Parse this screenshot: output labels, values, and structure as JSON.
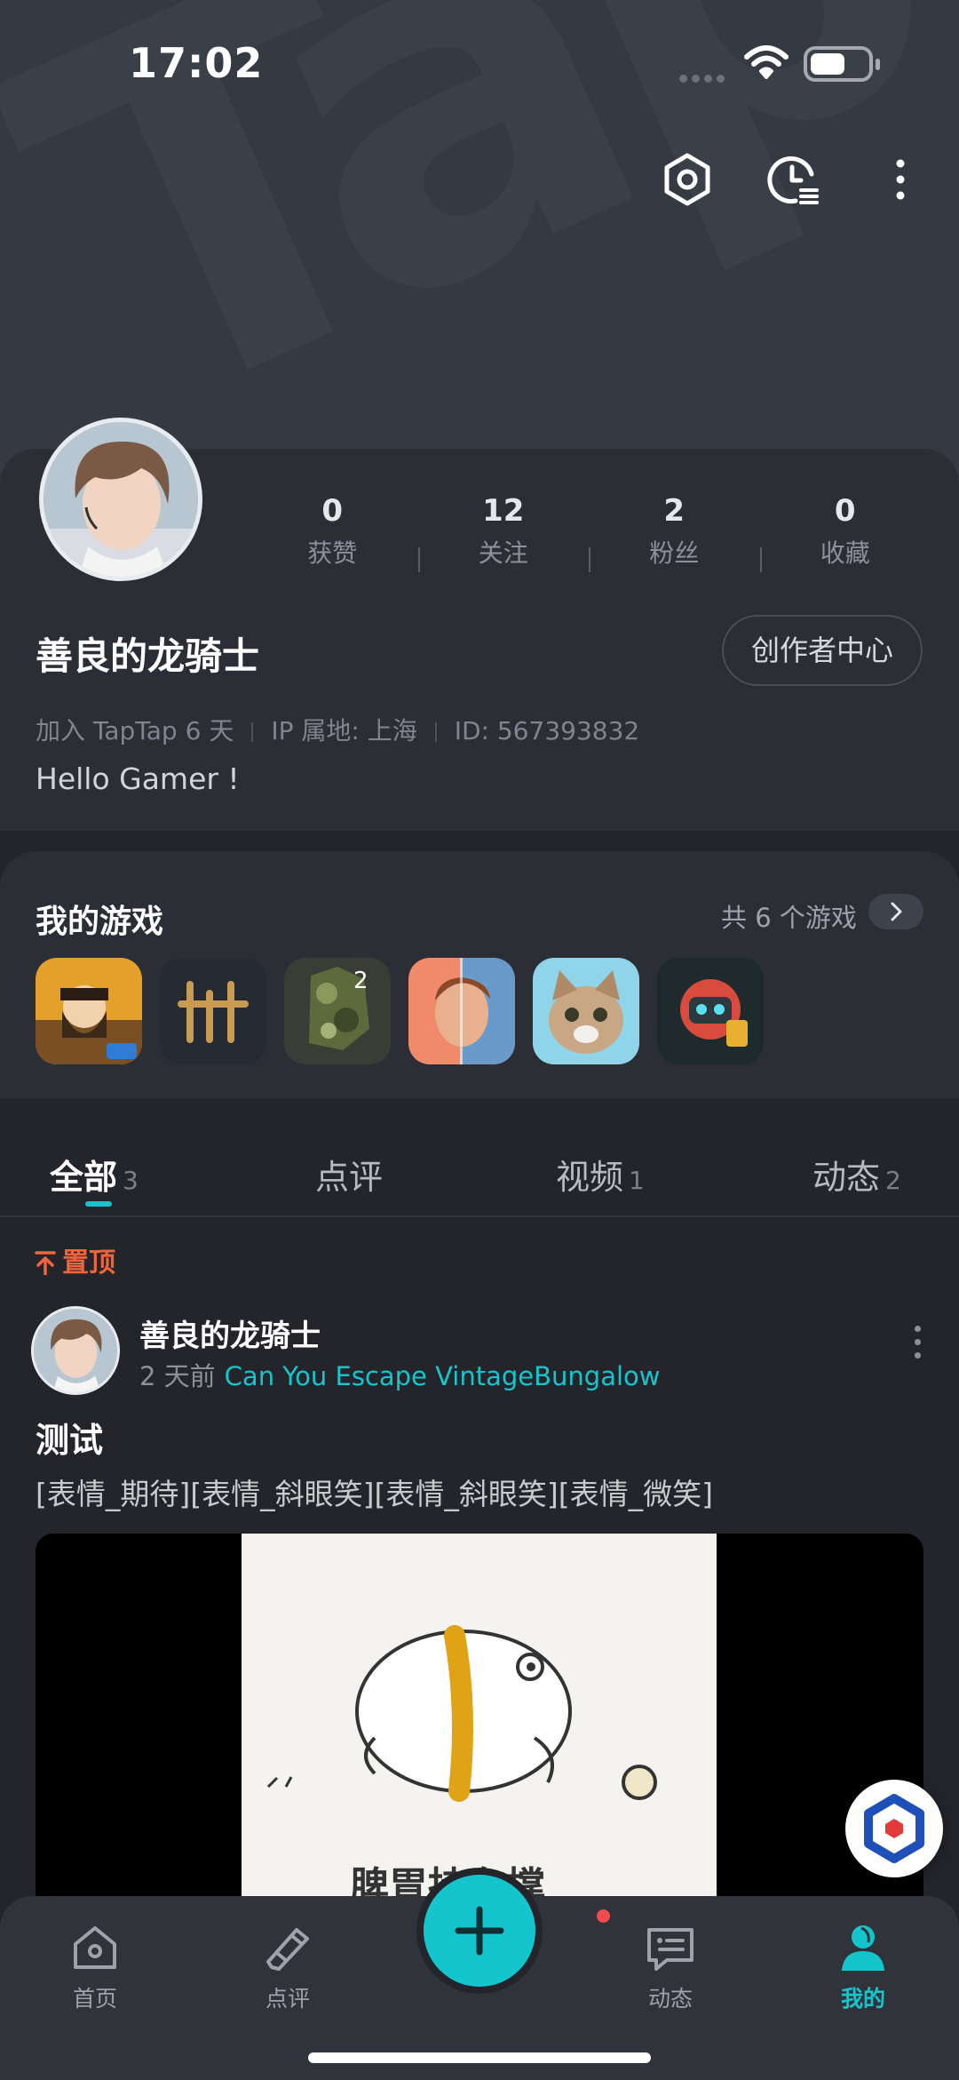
{
  "status_bar": {
    "time": "17:02"
  },
  "banner": {
    "watermark": "TapTap"
  },
  "profile": {
    "username": "善良的龙骑士",
    "stats": [
      {
        "value": "0",
        "label": "获赞"
      },
      {
        "value": "12",
        "label": "关注"
      },
      {
        "value": "2",
        "label": "粉丝"
      },
      {
        "value": "0",
        "label": "收藏"
      }
    ],
    "creator_center": "创作者中心",
    "joined": "加入 TapTap 6 天",
    "ip": "IP 属地: 上海",
    "id": "ID: 567393832",
    "bio": "Hello Gamer !"
  },
  "my_games": {
    "title": "我的游戏",
    "count_label": "共 6 个游戏"
  },
  "tabs": [
    {
      "label": "全部",
      "count": "3"
    },
    {
      "label": "点评",
      "count": ""
    },
    {
      "label": "视频",
      "count": "1"
    },
    {
      "label": "动态",
      "count": "2"
    }
  ],
  "post": {
    "pinned": "置顶",
    "author": "善良的龙骑士",
    "time": "2 天前",
    "game": "Can You Escape VintageBungalow",
    "title": "测试",
    "body": "[表情_期待][表情_斜眼笑][表情_斜眼笑][表情_微笑]",
    "image_caption": "脾胃持在撑"
  },
  "bottom_nav": [
    {
      "label": "首页",
      "icon": "home-icon"
    },
    {
      "label": "点评",
      "icon": "review-pen-icon"
    },
    {
      "label": "动态",
      "icon": "chat-icon"
    },
    {
      "label": "我的",
      "icon": "profile-icon"
    }
  ],
  "colors": {
    "accent": "#15c5ce",
    "pinned": "#f0643c",
    "background": "#23252b"
  }
}
